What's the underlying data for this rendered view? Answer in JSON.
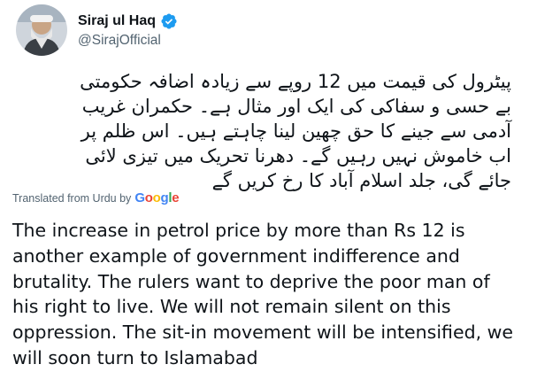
{
  "author": {
    "display_name": "Siraj ul Haq",
    "handle": "@SirajOfficial",
    "verified_icon": "verified-badge-icon",
    "avatar_icon": "profile-avatar"
  },
  "tweet": {
    "original_lines": [
      "پیٹرول کی قیمت میں 12 روپے سے زیادہ اضافہ حکومتی",
      "بے حسی و سفاکی کی ایک اور مثال ہے۔ حکمران غریب",
      "آدمی سے جینے کا حق چھین لینا چاہتے ہیں۔ اس ظلم پر",
      "اب خاموش نہیں رہیں گے۔ دھرنا تحریک میں تیزی لائی",
      "جائے گی، جلد اسلام آباد کا رخ کریں گے"
    ],
    "translation_label": "Translated from Urdu by",
    "translation_provider": {
      "letters": [
        "G",
        "o",
        "o",
        "g",
        "l",
        "e"
      ],
      "colors": [
        "#4285F4",
        "#EA4335",
        "#FBBC05",
        "#4285F4",
        "#34A853",
        "#EA4335"
      ]
    },
    "translated_lines": [
      "The increase in petrol price by more than Rs 12 is",
      "another example of government indifference and",
      "brutality. The rulers want to deprive the poor man of",
      "his right to live. We will not remain silent on this",
      "oppression. The sit-in movement will be intensified, we",
      "will soon turn to Islamabad"
    ]
  },
  "colors": {
    "text_primary": "#0f1419",
    "text_secondary": "#536471",
    "verified_blue": "#1d9bf0"
  }
}
